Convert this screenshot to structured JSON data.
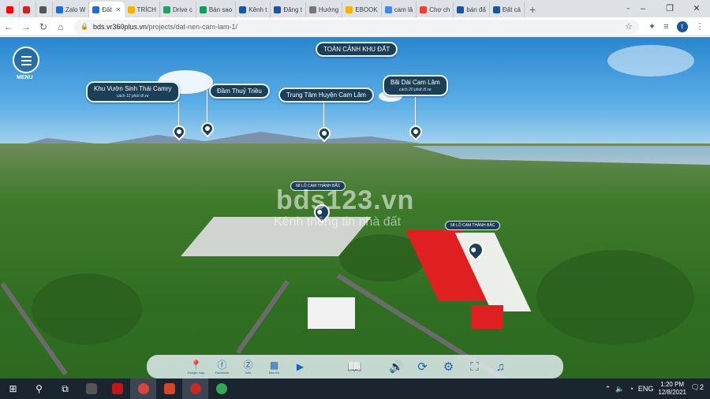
{
  "tabs": [
    {
      "label": "",
      "color": "#ff0000"
    },
    {
      "label": "",
      "color": "#d32020"
    },
    {
      "label": "",
      "color": "#555555"
    },
    {
      "label": "Zalo W",
      "color": "#1a6fd6"
    },
    {
      "label": "Đất",
      "color": "#1a6fd6",
      "active": true
    },
    {
      "label": "TRÍCH",
      "color": "#f4b400"
    },
    {
      "label": "Drive c",
      "color": "#1da462"
    },
    {
      "label": "Bản sao",
      "color": "#0f9d58"
    },
    {
      "label": "Kênh t",
      "color": "#1a56a0"
    },
    {
      "label": "Đăng t",
      "color": "#1a56a0"
    },
    {
      "label": "Hướng",
      "color": "#777777"
    },
    {
      "label": "EBOOK",
      "color": "#f4b400"
    },
    {
      "label": "cam lâ",
      "color": "#4285f4"
    },
    {
      "label": "Chợ ch",
      "color": "#ea4335"
    },
    {
      "label": "bán đấ",
      "color": "#1a56a0"
    },
    {
      "label": "Đất cả",
      "color": "#1a56a0"
    }
  ],
  "browser": {
    "url_host": "bds.vr360plus.vn",
    "url_path": "/projects/dat-nen-cam-lam-1/",
    "profile_initial": "t"
  },
  "tour": {
    "menu_label": "MENU",
    "overview_label": "TOÀN CẢNH KHU ĐẤT",
    "pois": [
      {
        "title": "Khu Vườn Sinh Thái Camry",
        "subtitle": "cách 12 phút đi xe"
      },
      {
        "title": "Đầm Thuỷ Triều",
        "subtitle": ""
      },
      {
        "title": "Trung Tâm Huyện Cam Lâm",
        "subtitle": ""
      },
      {
        "title": "Bãi Dài Cam Lâm",
        "subtitle": "cách 20 phút đi xe"
      }
    ],
    "lots": [
      "68 LÔ CAM THÀNH BẮC",
      "58 LÔ CAM THÀNH BẮC"
    ],
    "watermark": "bds123.vn",
    "watermark_sub": "Kênh thông tin nhà đất",
    "toolbar": [
      {
        "icon": "google-map",
        "label": "Google map"
      },
      {
        "icon": "facebook",
        "label": "Facebook"
      },
      {
        "icon": "zalo",
        "label": "Zalo"
      },
      {
        "icon": "map",
        "label": "Bản Đồ"
      },
      {
        "icon": "youtube",
        "label": ""
      }
    ]
  },
  "taskbar": {
    "time": "1:20 PM",
    "date": "12/8/2021",
    "lang": "ENG",
    "notify": "2"
  }
}
